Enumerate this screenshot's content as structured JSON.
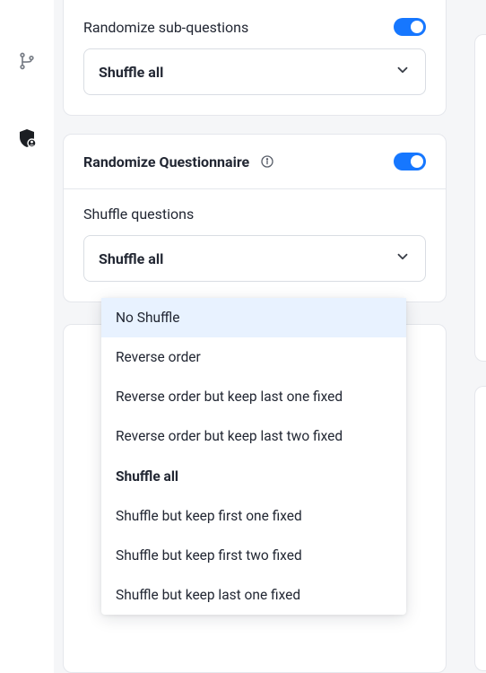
{
  "sidebar": {
    "items": [
      {
        "name": "branch-icon"
      },
      {
        "name": "shield-user-icon"
      }
    ]
  },
  "top_section": {
    "label": "Randomize sub-questions",
    "toggle_on": true,
    "select_value": "Shuffle all"
  },
  "questionnaire_card": {
    "heading": "Randomize Questionnaire",
    "toggle_on": true,
    "sub_label": "Shuffle questions",
    "select_value": "Shuffle all"
  },
  "dropdown": {
    "options": [
      {
        "label": "No Shuffle",
        "highlight": true,
        "selected": false
      },
      {
        "label": "Reverse order",
        "highlight": false,
        "selected": false
      },
      {
        "label": "Reverse order but keep last one fixed",
        "highlight": false,
        "selected": false
      },
      {
        "label": "Reverse order but keep last two fixed",
        "highlight": false,
        "selected": false
      },
      {
        "label": "Shuffle all",
        "highlight": false,
        "selected": true
      },
      {
        "label": "Shuffle but keep first one fixed",
        "highlight": false,
        "selected": false
      },
      {
        "label": "Shuffle but keep first two fixed",
        "highlight": false,
        "selected": false
      },
      {
        "label": "Shuffle but keep last one fixed",
        "highlight": false,
        "selected": false
      }
    ]
  }
}
